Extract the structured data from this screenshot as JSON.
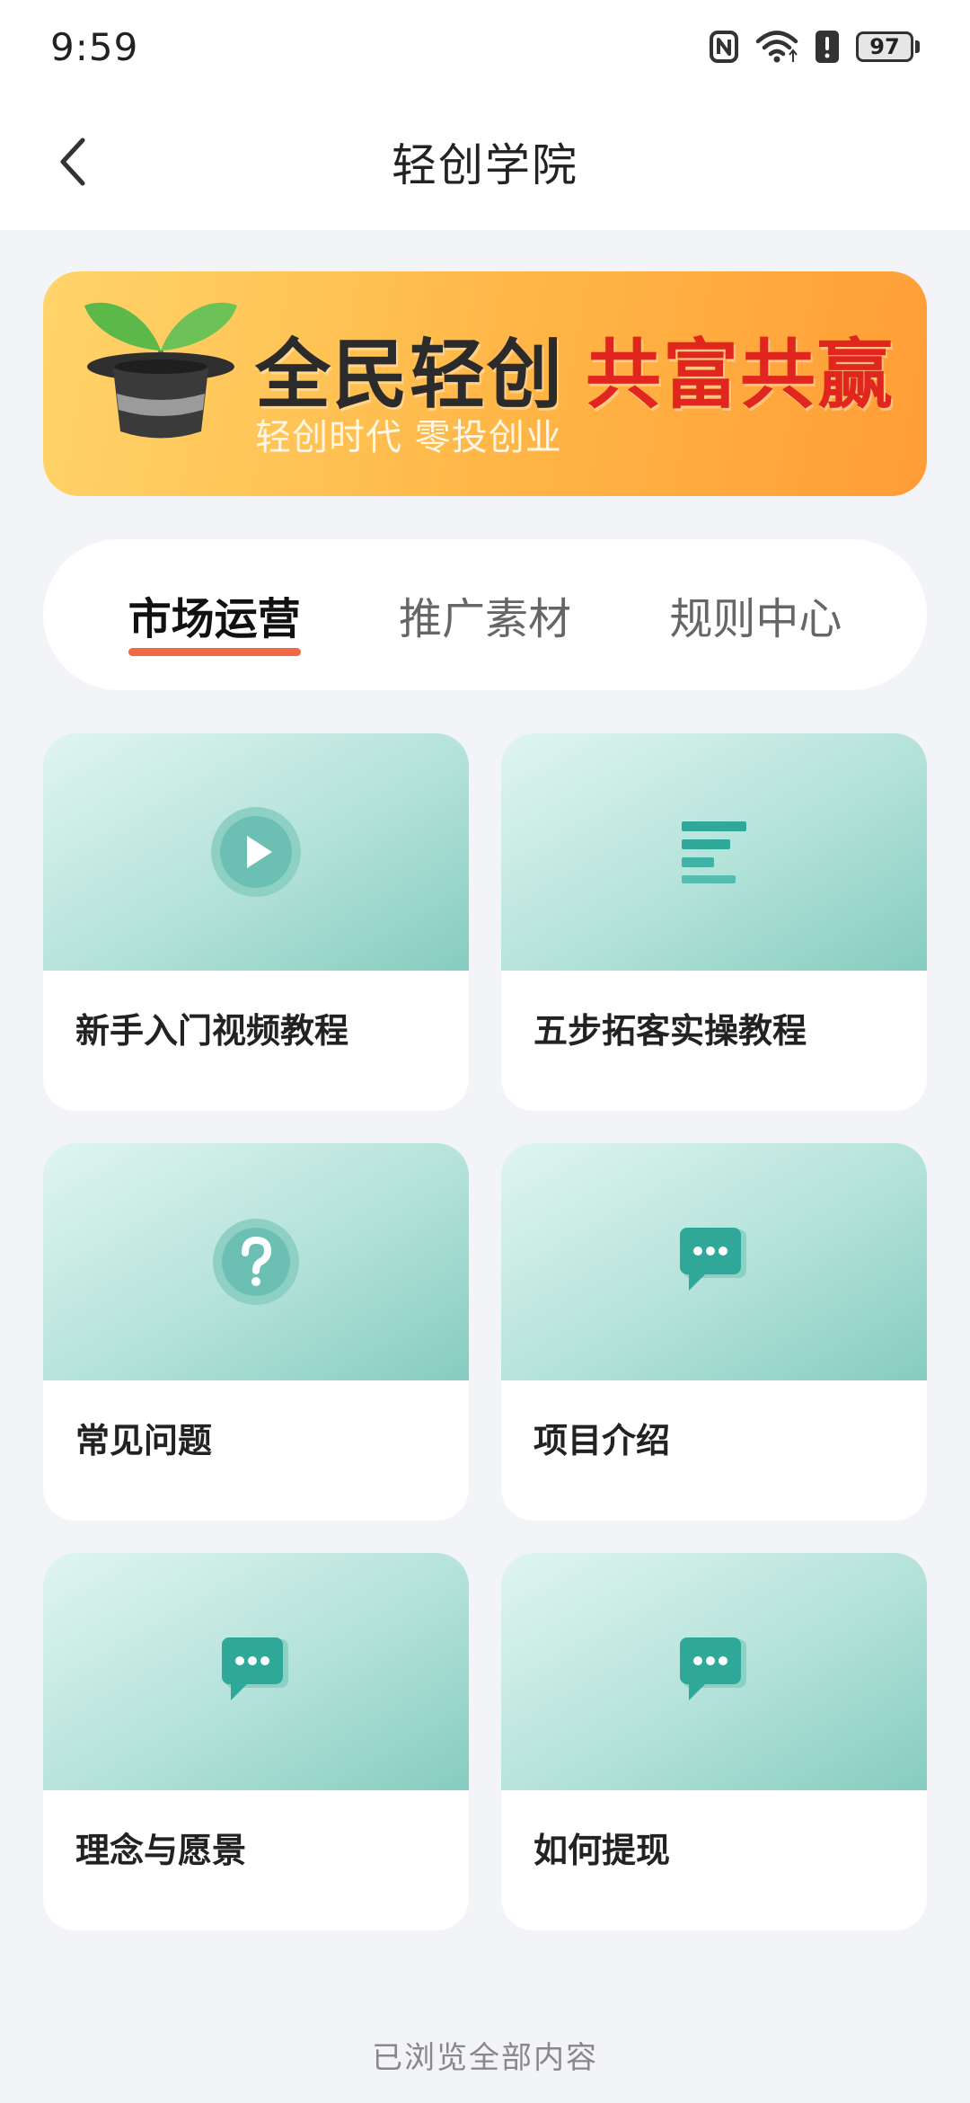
{
  "status": {
    "time": "9:59",
    "battery": "97"
  },
  "header": {
    "title": "轻创学院"
  },
  "banner": {
    "title_part1": "全民轻创",
    "title_part2": "共富共赢",
    "subtitle": "轻创时代 零投创业"
  },
  "tabs": [
    {
      "label": "市场运营",
      "active": true
    },
    {
      "label": "推广素材",
      "active": false
    },
    {
      "label": "规则中心",
      "active": false
    }
  ],
  "cards": [
    {
      "title": "新手入门视频教程",
      "icon": "play-icon"
    },
    {
      "title": "五步拓客实操教程",
      "icon": "text-lines-icon"
    },
    {
      "title": "常见问题",
      "icon": "question-icon"
    },
    {
      "title": "项目介绍",
      "icon": "chat-bubble-icon"
    },
    {
      "title": "理念与愿景",
      "icon": "chat-bubble-icon"
    },
    {
      "title": "如何提现",
      "icon": "chat-bubble-icon"
    }
  ],
  "footer": {
    "text": "已浏览全部内容"
  },
  "colors": {
    "accent": "#ef6a42",
    "teal": "#2fa89a",
    "background": "#f3f4f8"
  }
}
